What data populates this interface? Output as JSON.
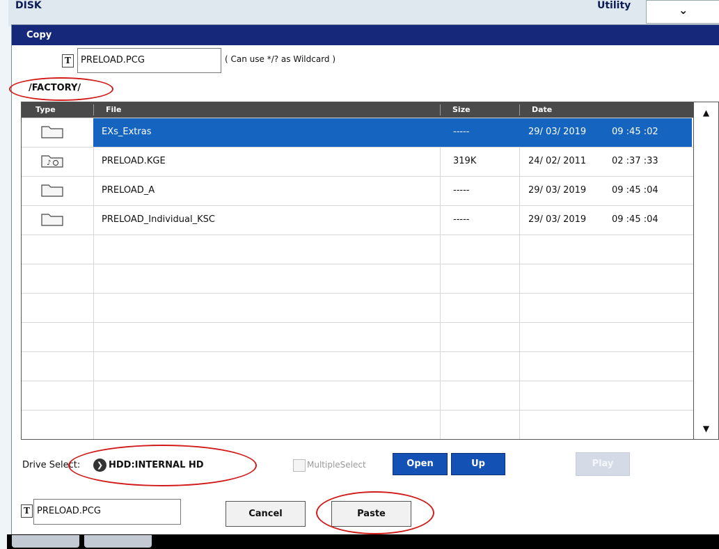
{
  "background": {
    "disk_label": "DISK",
    "utility_label": "Utility",
    "utility_dropdown_glyph": "⌄"
  },
  "dialog": {
    "title": "Copy",
    "source_t_icon": "T",
    "source_filename": "PRELOAD.PCG",
    "wildcard_hint": "( Can use */? as Wildcard )",
    "current_path": "/FACTORY/"
  },
  "table": {
    "headers": {
      "type": "Type",
      "file": "File",
      "size": "Size",
      "date": "Date"
    },
    "rows": [
      {
        "icon": "folder-icon",
        "file": "EXs_Extras",
        "size": "-----",
        "date": "29/ 03/ 2019",
        "time": "09 :45 :02",
        "selected": true
      },
      {
        "icon": "kge-file-icon",
        "file": "PRELOAD.KGE",
        "size": "319K",
        "date": "24/ 02/ 2011",
        "time": "02 :37 :33",
        "selected": false
      },
      {
        "icon": "folder-icon",
        "file": "PRELOAD_A",
        "size": "-----",
        "date": "29/ 03/ 2019",
        "time": "09 :45 :04",
        "selected": false
      },
      {
        "icon": "folder-icon",
        "file": "PRELOAD_Individual_KSC",
        "size": "-----",
        "date": "29/ 03/ 2019",
        "time": "09 :45 :04",
        "selected": false
      }
    ],
    "scroll_up": "▲",
    "scroll_down": "▼"
  },
  "controls": {
    "drive_select_label": "Drive Select:",
    "drive_arrow": "❯",
    "drive_value": "HDD:INTERNAL HD",
    "multiple_select_label": "MultipleSelect",
    "open_label": "Open",
    "up_label": "Up",
    "play_label": "Play",
    "dest_t_icon": "T",
    "dest_filename": "PRELOAD.PCG",
    "cancel_label": "Cancel",
    "paste_label": "Paste"
  },
  "colors": {
    "title_bar": "#16287a",
    "selection": "#1565c0",
    "annotation": "#d21a1a"
  }
}
